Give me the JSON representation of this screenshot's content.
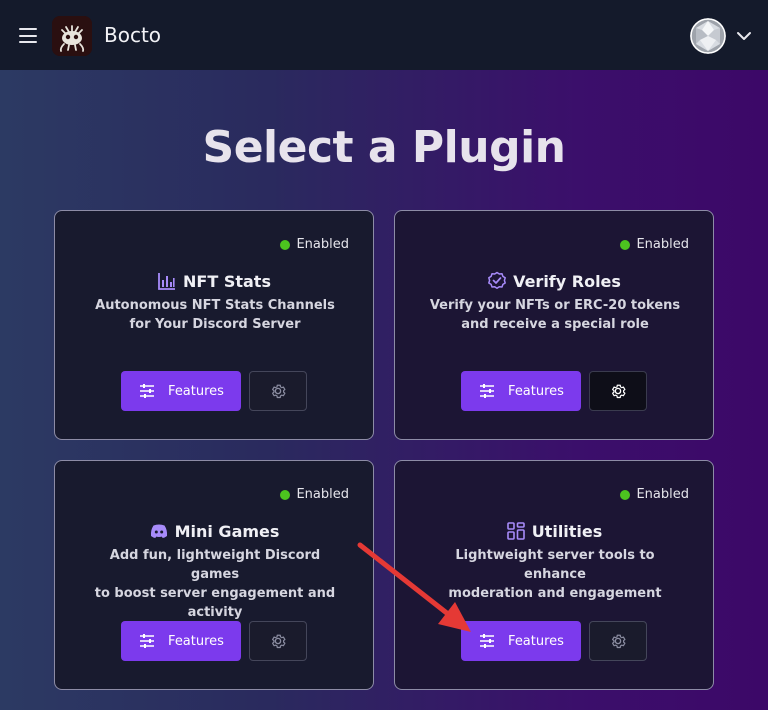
{
  "header": {
    "brand": "Bocto",
    "menu_icon": "hamburger-menu-icon",
    "avatar_icon": "user-avatar",
    "dropdown_icon": "chevron-down-icon"
  },
  "page": {
    "title": "Select a Plugin"
  },
  "colors": {
    "accent": "#7c3aed",
    "enabled": "#4cc41f",
    "arrow": "#e53935"
  },
  "plugins": [
    {
      "status": "Enabled",
      "icon": "bar-chart-icon",
      "title": "NFT Stats",
      "desc_line1": "Autonomous NFT Stats Channels",
      "desc_line2": "for Your Discord Server",
      "features_label": "Features"
    },
    {
      "status": "Enabled",
      "icon": "check-badge-icon",
      "title": "Verify Roles",
      "desc_line1": "Verify your NFTs or ERC-20 tokens",
      "desc_line2": "and receive a special role",
      "features_label": "Features"
    },
    {
      "status": "Enabled",
      "icon": "discord-icon",
      "title": "Mini Games",
      "desc_line1": "Add fun, lightweight Discord games",
      "desc_line2": "to boost server engagement and",
      "desc_line3": "activity",
      "features_label": "Features"
    },
    {
      "status": "Enabled",
      "icon": "grid-icon",
      "title": "Utilities",
      "desc_line1": "Lightweight server tools to enhance",
      "desc_line2": "moderation and engagement",
      "features_label": "Features"
    }
  ]
}
